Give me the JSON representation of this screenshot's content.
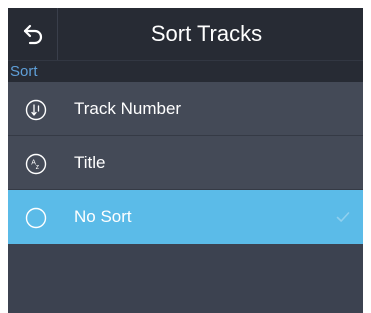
{
  "header": {
    "title": "Sort Tracks",
    "back_icon": "back-arrow-icon"
  },
  "section": {
    "label": "Sort"
  },
  "options": [
    {
      "label": "Track Number",
      "icon": "sort-descending-icon",
      "selected": false
    },
    {
      "label": "Title",
      "icon": "alphabetical-sort-icon",
      "selected": false
    },
    {
      "label": "No Sort",
      "icon": "circle-icon",
      "selected": true
    }
  ],
  "colors": {
    "header_bg": "#272b34",
    "panel_bg": "#3c4250",
    "row_bg": "#444a57",
    "selected_bg": "#5bbbe8",
    "section_text": "#5f9fd8",
    "text": "#ffffff"
  }
}
